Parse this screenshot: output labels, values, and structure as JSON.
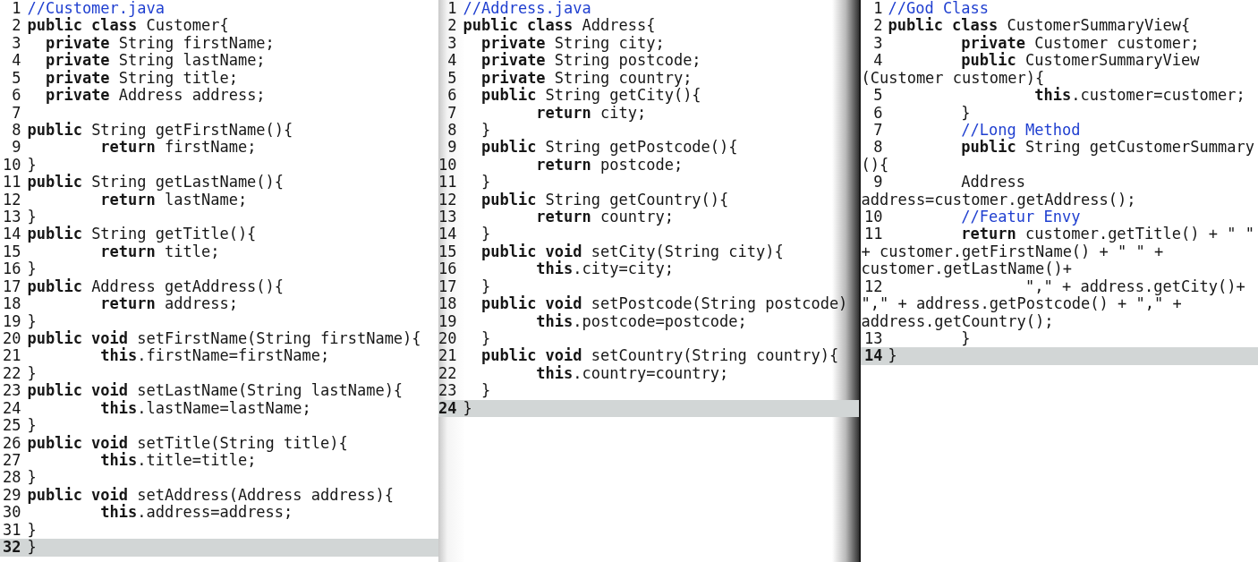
{
  "panes": [
    {
      "lines": [
        {
          "num": "1",
          "kind": "comment",
          "code": "//Customer.java",
          "current": false
        },
        {
          "num": "2",
          "kind": "code",
          "code": "**public class** Customer{",
          "current": false
        },
        {
          "num": "3",
          "kind": "code",
          "code": "  **private** String firstName;",
          "current": false
        },
        {
          "num": "4",
          "kind": "code",
          "code": "  **private** String lastName;",
          "current": false
        },
        {
          "num": "5",
          "kind": "code",
          "code": "  **private** String title;",
          "current": false
        },
        {
          "num": "6",
          "kind": "code",
          "code": "  **private** Address address;",
          "current": false
        },
        {
          "num": "7",
          "current": false
        },
        {
          "num": "8",
          "kind": "code",
          "code": "**public** String getFirstName(){",
          "current": false
        },
        {
          "num": "9",
          "kind": "code",
          "code": "        **return** firstName;",
          "current": false
        },
        {
          "num": "10",
          "kind": "code",
          "code": "}",
          "current": false
        },
        {
          "num": "11",
          "kind": "code",
          "code": "**public** String getLastName(){",
          "current": false
        },
        {
          "num": "12",
          "kind": "code",
          "code": "        **return** lastName;",
          "current": false
        },
        {
          "num": "13",
          "kind": "code",
          "code": "}",
          "current": false
        },
        {
          "num": "14",
          "kind": "code",
          "code": "**public** String getTitle(){",
          "current": false
        },
        {
          "num": "15",
          "kind": "code",
          "code": "        **return** title;",
          "current": false
        },
        {
          "num": "16",
          "kind": "code",
          "code": "}",
          "current": false
        },
        {
          "num": "17",
          "kind": "code",
          "code": "**public** Address getAddress(){",
          "current": false
        },
        {
          "num": "18",
          "kind": "code",
          "code": "        **return** address;",
          "current": false
        },
        {
          "num": "19",
          "kind": "code",
          "code": "}",
          "current": false
        },
        {
          "num": "20",
          "kind": "code",
          "code": "**public void** setFirstName(String firstName){",
          "current": false
        },
        {
          "num": "21",
          "kind": "code",
          "code": "        **this**.firstName=firstName;",
          "current": false
        },
        {
          "num": "22",
          "kind": "code",
          "code": "}",
          "current": false
        },
        {
          "num": "23",
          "kind": "code",
          "code": "**public void** setLastName(String lastName){",
          "current": false
        },
        {
          "num": "24",
          "kind": "code",
          "code": "        **this**.lastName=lastName;",
          "current": false
        },
        {
          "num": "25",
          "kind": "code",
          "code": "}",
          "current": false
        },
        {
          "num": "26",
          "kind": "code",
          "code": "**public void** setTitle(String title){",
          "current": false
        },
        {
          "num": "27",
          "kind": "code",
          "code": "        **this**.title=title;",
          "current": false
        },
        {
          "num": "28",
          "kind": "code",
          "code": "}",
          "current": false
        },
        {
          "num": "29",
          "kind": "code",
          "code": "**public void** setAddress(Address address){",
          "current": false
        },
        {
          "num": "30",
          "kind": "code",
          "code": "        **this**.address=address;",
          "current": false
        },
        {
          "num": "31",
          "kind": "code",
          "code": "}",
          "current": false
        },
        {
          "num": "32",
          "kind": "code",
          "code": "}",
          "current": true
        }
      ]
    },
    {
      "lines": [
        {
          "num": "1",
          "kind": "comment",
          "code": "//Address.java",
          "current": false
        },
        {
          "num": "2",
          "kind": "code",
          "code": "**public class** Address{",
          "current": false
        },
        {
          "num": "3",
          "kind": "code",
          "code": "  **private** String city;",
          "current": false
        },
        {
          "num": "4",
          "kind": "code",
          "code": "  **private** String postcode;",
          "current": false
        },
        {
          "num": "5",
          "kind": "code",
          "code": "  **private** String country;",
          "current": false
        },
        {
          "num": "6",
          "kind": "code",
          "code": "  **public** String getCity(){",
          "current": false
        },
        {
          "num": "7",
          "kind": "code",
          "code": "        **return** city;",
          "current": false
        },
        {
          "num": "8",
          "kind": "code",
          "code": "  }",
          "current": false
        },
        {
          "num": "9",
          "kind": "code",
          "code": "  **public** String getPostcode(){",
          "current": false
        },
        {
          "num": "10",
          "kind": "code",
          "code": "        **return** postcode;",
          "current": false
        },
        {
          "num": "11",
          "kind": "code",
          "code": "  }",
          "current": false
        },
        {
          "num": "12",
          "kind": "code",
          "code": "  **public** String getCountry(){",
          "current": false
        },
        {
          "num": "13",
          "kind": "code",
          "code": "        **return** country;",
          "current": false
        },
        {
          "num": "14",
          "kind": "code",
          "code": "  }",
          "current": false
        },
        {
          "num": "15",
          "kind": "code",
          "code": "  **public void** setCity(String city){",
          "current": false
        },
        {
          "num": "16",
          "kind": "code",
          "code": "        **this**.city=city;",
          "current": false
        },
        {
          "num": "17",
          "kind": "code",
          "code": "  }",
          "current": false
        },
        {
          "num": "18",
          "kind": "code",
          "code": "  **public void** setPostcode(String postcode)",
          "current": false
        },
        {
          "num": "19",
          "kind": "code",
          "code": "        **this**.postcode=postcode;",
          "current": false
        },
        {
          "num": "20",
          "kind": "code",
          "code": "  }",
          "current": false
        },
        {
          "num": "21",
          "kind": "code",
          "code": "  **public void** setCountry(String country){",
          "current": false
        },
        {
          "num": "22",
          "kind": "code",
          "code": "        **this**.country=country;",
          "current": false
        },
        {
          "num": "23",
          "kind": "code",
          "code": "  }",
          "current": false
        },
        {
          "num": "24",
          "kind": "code",
          "code": "}",
          "current": true
        }
      ]
    },
    {
      "lines": [
        {
          "num": "1",
          "kind": "comment",
          "code": "//God Class",
          "current": false
        },
        {
          "num": "2",
          "kind": "code",
          "code": "**public class** CustomerSummaryView{",
          "current": false
        },
        {
          "num": "3",
          "kind": "code",
          "code": "        **private** Customer customer;",
          "current": false
        },
        {
          "num": "4",
          "kind": "code",
          "rows": [
            "        **public** CustomerSummaryView",
            "(Customer customer){"
          ],
          "current": false
        },
        {
          "num": "5",
          "kind": "code",
          "code": "                **this**.customer=customer;",
          "current": false
        },
        {
          "num": "6",
          "kind": "code",
          "code": "        }",
          "current": false
        },
        {
          "num": "7",
          "kind": "comment",
          "code": "        //Long Method",
          "current": false
        },
        {
          "num": "8",
          "kind": "code",
          "rows": [
            "        **public** String getCustomerSummary",
            "(){"
          ],
          "current": false
        },
        {
          "num": "9",
          "kind": "code",
          "rows": [
            "        Address",
            "address=customer.getAddress();"
          ],
          "current": false
        },
        {
          "num": "10",
          "kind": "comment",
          "code": "        //Featur Envy",
          "current": false
        },
        {
          "num": "11",
          "kind": "code",
          "rows": [
            "        **return** customer.getTitle() + \" \"",
            "+ customer.getFirstName() + \" \" +",
            "customer.getLastName()+"
          ],
          "current": false
        },
        {
          "num": "12",
          "kind": "code",
          "rows": [
            "               \",\" + address.getCity()+",
            "\",\" + address.getPostcode() + \",\" +",
            "address.getCountry();"
          ],
          "current": false
        },
        {
          "num": "13",
          "kind": "code",
          "code": "        }",
          "current": false
        },
        {
          "num": "14",
          "kind": "code",
          "code": "}",
          "current": true
        }
      ]
    }
  ]
}
